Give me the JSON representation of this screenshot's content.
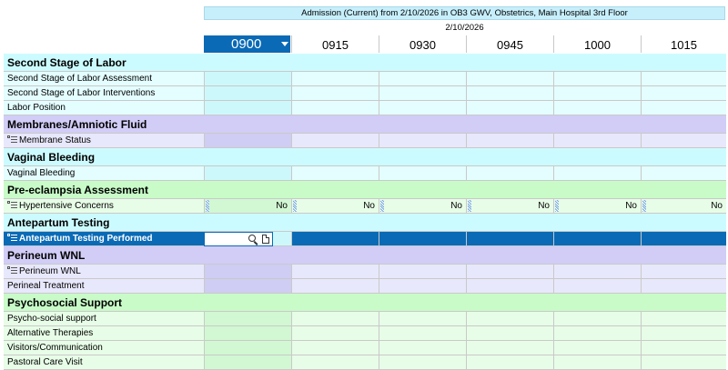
{
  "header": {
    "banner": "Admission (Current) from 2/10/2026 in OB3 GWV, Obstetrics, Main Hospital 3rd Floor",
    "date": "2/10/2026",
    "selected_time": "0900",
    "times": [
      "0915",
      "0930",
      "0945",
      "1000",
      "1015"
    ]
  },
  "colors": {
    "selected": "#0a6ab5",
    "cyan_section": "#ccfbff",
    "cyan_row": "#e4fdff",
    "cyan_first": "#cdf8fb",
    "purple_section": "#d1cdf7",
    "purple_row": "#e8e8fc",
    "purple_first": "#cfcdf3",
    "green_section": "#c8fbc8",
    "green_row": "#e7fde7",
    "green_first": "#d1f8d2"
  },
  "rows": [
    {
      "kind": "section",
      "label": "Second Stage of Labor",
      "theme": "cyan"
    },
    {
      "kind": "row",
      "label": "Second Stage of Labor Assessment",
      "theme": "cyan"
    },
    {
      "kind": "row",
      "label": "Second Stage of Labor Interventions",
      "theme": "cyan"
    },
    {
      "kind": "row",
      "label": "Labor Position",
      "theme": "cyan"
    },
    {
      "kind": "section",
      "label": "Membranes/Amniotic Fluid",
      "theme": "purple"
    },
    {
      "kind": "row",
      "label": "Membrane Status",
      "theme": "purple",
      "icon": true
    },
    {
      "kind": "section",
      "label": "Vaginal Bleeding",
      "theme": "cyan"
    },
    {
      "kind": "row",
      "label": "Vaginal Bleeding",
      "theme": "cyan"
    },
    {
      "kind": "section",
      "label": "Pre-eclampsia Assessment",
      "theme": "green"
    },
    {
      "kind": "row",
      "label": "Hypertensive Concerns",
      "theme": "green",
      "icon": true,
      "values": [
        "No",
        "No",
        "No",
        "No",
        "No",
        "No"
      ]
    },
    {
      "kind": "section",
      "label": "Antepartum Testing",
      "theme": "cyan"
    },
    {
      "kind": "row",
      "label": "Antepartum Testing Performed",
      "theme": "cyan",
      "icon": true,
      "active": true
    },
    {
      "kind": "section",
      "label": "Perineum WNL",
      "theme": "purple"
    },
    {
      "kind": "row",
      "label": "Perineum WNL",
      "theme": "purple",
      "icon": true
    },
    {
      "kind": "row",
      "label": "Perineal Treatment",
      "theme": "purple"
    },
    {
      "kind": "section",
      "label": "Psychosocial Support",
      "theme": "green"
    },
    {
      "kind": "row",
      "label": "Psycho-social support",
      "theme": "green"
    },
    {
      "kind": "row",
      "label": "Alternative Therapies",
      "theme": "green"
    },
    {
      "kind": "row",
      "label": "Visitors/Communication",
      "theme": "green"
    },
    {
      "kind": "row",
      "label": "Pastoral Care Visit",
      "theme": "green"
    }
  ]
}
